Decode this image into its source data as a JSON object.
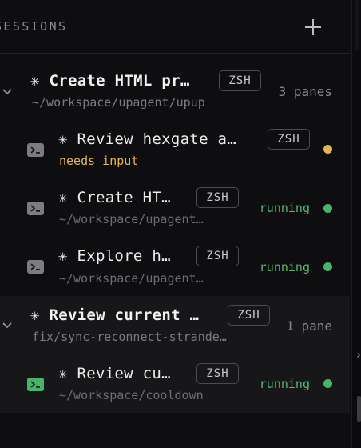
{
  "header": {
    "title": "SESSIONS",
    "add_label": "+"
  },
  "groups": [
    {
      "title": "✳ Create HTML pr…",
      "shell": "ZSH",
      "path": "~/workspace/upagent/upup",
      "meta": "3 panes",
      "items": [
        {
          "title": "✳ Review hexgate a…",
          "shell": "ZSH",
          "sub": "needs input",
          "status": "",
          "dot_color": "#e5b25a",
          "icon": "terminal-icon"
        },
        {
          "title": "✳ Create HT…",
          "shell": "ZSH",
          "sub": "~/workspace/upagent…",
          "status": "running",
          "dot_color": "#4ab36a",
          "icon": "terminal-icon"
        },
        {
          "title": "✳ Explore h…",
          "shell": "ZSH",
          "sub": "~/workspace/upagent…",
          "status": "running",
          "dot_color": "#4ab36a",
          "icon": "terminal-icon"
        }
      ]
    },
    {
      "title": "✳ Review current …",
      "shell": "ZSH",
      "path": "fix/sync-reconnect-strande…",
      "meta": "1 pane",
      "items": [
        {
          "title": "✳ Review cu…",
          "shell": "ZSH",
          "sub": "~/workspace/cooldown",
          "status": "running",
          "dot_color": "#4ab36a",
          "icon": "terminal-icon"
        }
      ]
    }
  ],
  "colors": {
    "running": "#59b86f",
    "needs_input": "#e2b35b",
    "active_terminal": "#4ab36a"
  }
}
